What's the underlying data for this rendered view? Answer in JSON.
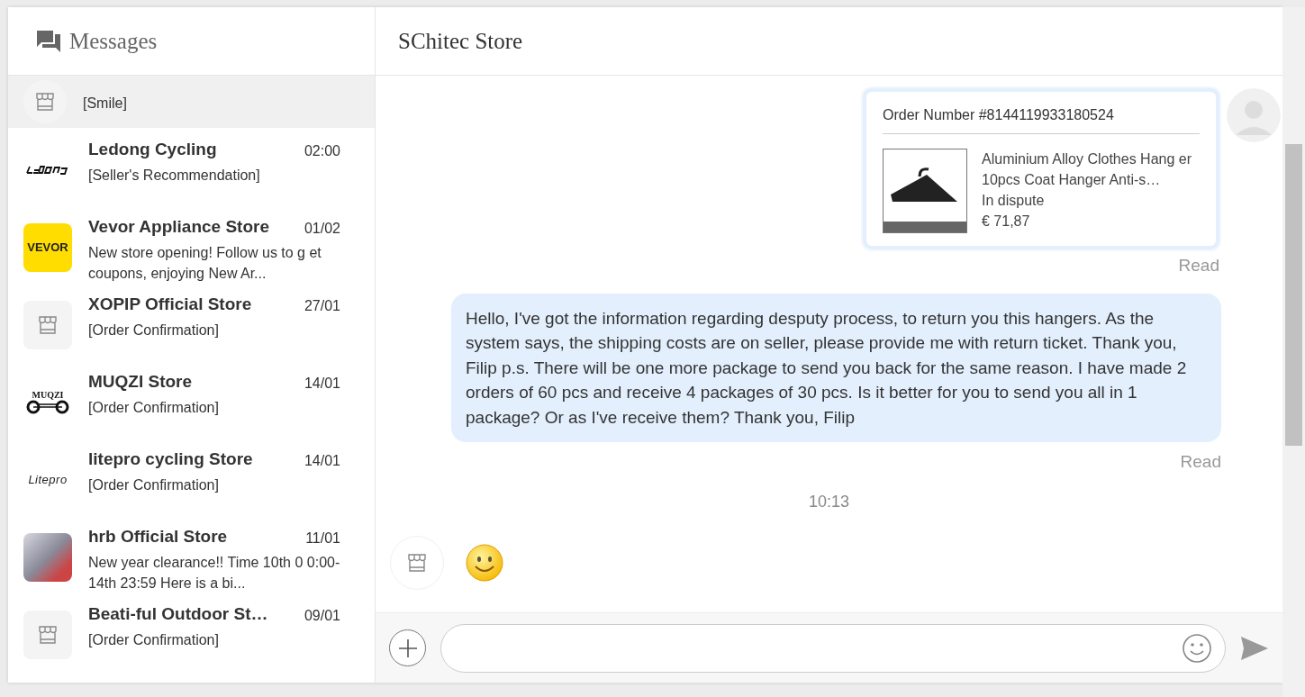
{
  "sidebar": {
    "title": "Messages",
    "conversations": [
      {
        "kind": "store",
        "preview": "[Smile]",
        "selected": true
      },
      {
        "name": "Ledong Cycling",
        "time": "02:00",
        "preview": "[Seller's Recommendation]",
        "kind": "ledong",
        "selected": false
      },
      {
        "name": "Vevor Appliance Store",
        "time": "01/02",
        "preview": "New store opening! Follow us to g et coupons, enjoying New Ar...",
        "kind": "vevor",
        "logo_text": "VEVOR",
        "selected": false
      },
      {
        "name": "XOPIP Official Store",
        "time": "27/01",
        "preview": "[Order Confirmation]",
        "kind": "store",
        "selected": false
      },
      {
        "name": "MUQZI Store",
        "time": "14/01",
        "preview": "[Order Confirmation]",
        "kind": "muqzi",
        "logo_text": "MUQZI",
        "selected": false
      },
      {
        "name": "litepro cycling Store",
        "time": "14/01",
        "preview": "[Order Confirmation]",
        "kind": "litepro",
        "logo_text": "Litepro",
        "selected": false
      },
      {
        "name": "hrb Official Store",
        "time": "11/01",
        "preview": "New year clearance!! Time 10th 0 0:00-14th 23:59 Here is a bi...",
        "kind": "photo",
        "selected": false
      },
      {
        "name": "Beati-ful Outdoor St…",
        "time": "09/01",
        "preview": "[Order Confirmation]",
        "kind": "store",
        "selected": false
      }
    ]
  },
  "chat": {
    "title": "SChitec Store",
    "messages": [
      {
        "kind": "order",
        "order_number": "Order Number #8144119933180524",
        "product": "Aluminium Alloy Clothes Hang er 10pcs Coat Hanger Anti-s…",
        "status": "In dispute",
        "price": "€ 71,87",
        "receipt": "Read"
      },
      {
        "kind": "text",
        "text": "Hello, I've got the information regarding desputy process, to return you this hangers. As the system says, the shipping costs are on seller, please provide me with return ticket. Thank you, Filip p.s. There will be one more package to send you back for the same reason. I have made 2 orders of 60 pcs and receive 4 packages of 30 pcs. Is it better for you to send you all in 1 package? Or as I've receive them? Thank you, Filip",
        "receipt": "Read"
      },
      {
        "kind": "time",
        "text": "10:13"
      },
      {
        "kind": "emoji"
      }
    ]
  }
}
